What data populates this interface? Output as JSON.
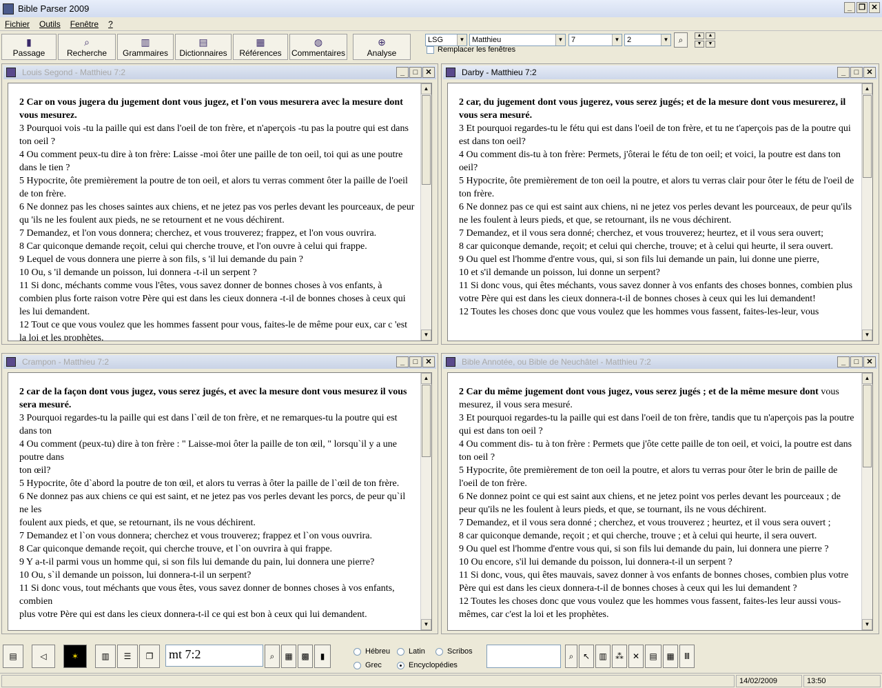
{
  "app": {
    "title": "Bible Parser 2009"
  },
  "menu": [
    "Fichier",
    "Outils",
    "Fenêtre",
    "?"
  ],
  "toolbar": {
    "buttons": [
      "Passage",
      "Recherche",
      "Grammaires",
      "Dictionnaires",
      "Références",
      "Commentaires",
      "Analyse"
    ],
    "version": "LSG",
    "book": "Matthieu",
    "chapter": "7",
    "verse": "2",
    "replace_windows_label": "Remplacer les fenêtres"
  },
  "panes": [
    {
      "title": "Louis Segond - Matthieu 7:2",
      "first_verse": "2 Car on vous jugera du jugement dont vous jugez, et l'on vous mesurera avec la mesure dont vous mesurez.",
      "verses": [
        "3 Pourquoi vois -tu la paille qui est dans l'oeil de ton frère, et n'aperçois -tu pas la poutre qui est dans ton oeil ?",
        "4 Ou comment peux-tu dire à ton frère: Laisse -moi ôter une paille de ton oeil, toi qui as une poutre dans le tien ?",
        "5 Hypocrite, ôte premièrement la poutre de ton oeil, et alors tu verras comment ôter la paille de l'oeil de ton frère.",
        "6 Ne donnez pas les choses saintes aux chiens, et ne jetez pas vos perles devant les pourceaux, de peur qu 'ils ne les foulent aux pieds, ne se retournent et ne vous déchirent.",
        "7 Demandez, et l'on vous donnera; cherchez, et vous trouverez; frappez, et l'on vous ouvrira.",
        "8 Car quiconque demande reçoit, celui qui cherche trouve, et l'on ouvre à celui qui frappe.",
        "9 Lequel de vous donnera une pierre à son fils, s 'il lui demande du pain ?",
        "10 Ou, s 'il demande un poisson, lui donnera -t-il un serpent ?",
        "11 Si donc, méchants comme vous l'êtes, vous savez donner de bonnes choses à vos enfants, à combien plus forte raison votre Père qui est dans les cieux donnera -t-il de bonnes choses à ceux qui les lui demandent.",
        "12 Tout ce que vous voulez que les hommes fassent pour vous, faites-le de même pour eux, car c 'est la loi et les prophètes."
      ]
    },
    {
      "title": "Darby - Matthieu 7:2",
      "first_verse": "2 car, du jugement dont vous jugerez, vous serez jugés; et de la mesure dont vous mesurerez, il vous sera mesuré.",
      "verses": [
        "3 Et pourquoi regardes-tu le fétu qui est dans l'oeil de ton frère, et tu ne t'aperçois pas de la poutre qui est dans ton oeil?",
        "4 Ou comment dis-tu à ton frère: Permets, j'ôterai le fétu de ton oeil; et voici, la poutre est dans ton oeil?",
        "5 Hypocrite, ôte premièrement de ton oeil la poutre, et alors tu verras clair pour ôter le fétu de l'oeil de ton frère.",
        "6 Ne donnez pas ce qui est saint aux chiens, ni ne jetez vos perles devant les pourceaux, de peur qu'ils ne les foulent à leurs pieds, et que, se retournant, ils ne vous déchirent.",
        "7 Demandez, et il vous sera donné; cherchez, et vous trouverez; heurtez, et il vous sera ouvert;",
        "8 car quiconque demande, reçoit; et celui qui cherche, trouve; et à celui qui heurte, il sera ouvert.",
        "9 Ou quel est l'homme d'entre vous, qui, si son fils lui demande un pain, lui donne une pierre,",
        "10 et s'il demande un poisson, lui donne un serpent?",
        "11 Si donc vous, qui êtes méchants, vous savez donner à vos enfants des choses bonnes, combien plus votre Père qui est dans les cieux donnera-t-il de bonnes choses à ceux qui les lui demandent!",
        "12 Toutes les choses donc que vous voulez que les hommes vous fassent, faites-les-leur, vous"
      ]
    },
    {
      "title": "Crampon - Matthieu 7:2",
      "first_verse": "2 car de la façon dont vous jugez, vous serez jugés, et avec la mesure dont vous mesurez il vous sera mesuré.",
      "verses": [
        "3 Pourquoi regardes-tu la paille qui est dans l`œil de ton frère, et ne remarques-tu la poutre qui est dans ton",
        "4 Ou comment (peux-tu) dire à ton frère : \" Laisse-moi ôter la paille de ton œil, \" lorsqu`il y a une poutre dans",
        "ton œil?",
        "5 Hypocrite, ôte d`abord la poutre de ton œil, et alors tu verras à ôter la paille de l`œil de ton frère.",
        "6 Ne donnez pas aux chiens ce qui est saint, et ne jetez pas vos perles devant les porcs, de peur qu`il ne les",
        "foulent aux pieds, et que, se retournant, ils ne vous déchirent.",
        "7 Demandez et l`on vous donnera; cherchez et vous trouverez; frappez et l`on vous ouvrira.",
        "8 Car quiconque demande reçoit, qui cherche trouve, et l`on ouvrira à qui frappe.",
        "9 Y a-t-il parmi vous un homme qui, si son fils lui demande du pain, lui donnera une pierre?",
        "10 Ou, s`il demande un poisson, lui donnera-t-il un serpent?",
        "11 Si donc vous, tout méchants que vous êtes, vous savez donner de bonnes choses à vos enfants, combien",
        "plus votre Père qui est dans les cieux donnera-t-il ce qui est bon à ceux qui lui demandent."
      ]
    },
    {
      "title": "Bible Annotée, ou Bible de Neuchâtel - Matthieu 7:2",
      "first_verse_bold": "2 Car du même jugement dont vous jugez, vous serez jugés ; et de la même mesure dont",
      "first_verse_rest": " vous mesurez, il vous sera mesuré.",
      "verses": [
        "3 Et pourquoi regardes-tu la paille qui est dans l'oeil de ton frère, tandis que tu n'aperçois pas la poutre qui est dans ton oeil ?",
        "4 Ou comment dis- tu à ton frère : Permets que j'ôte cette paille de ton oeil, et voici, la poutre est dans ton oeil ?",
        "5 Hypocrite, ôte premièrement de ton oeil la poutre, et alors tu verras pour ôter le brin de paille de l'oeil de ton frère.",
        "6 Ne donnez point ce qui est saint aux chiens, et ne jetez point vos perles devant les pourceaux ; de peur qu'ils ne les foulent à leurs pieds, et que, se tournant, ils ne vous déchirent.",
        "7 Demandez, et il vous sera donné ; cherchez, et vous trouverez ; heurtez, et il vous sera ouvert ;",
        "8 car quiconque demande, reçoit ; et qui cherche, trouve ; et à celui qui heurte, il sera ouvert.",
        "9 Ou quel est l'homme d'entre vous qui, si son fils lui demande du pain, lui donnera une pierre ?",
        "10 Ou encore, s'il lui demande du poisson, lui donnera-t-il un serpent ?",
        "11 Si donc, vous, qui êtes mauvais, savez donner à vos enfants de bonnes choses, combien plus votre Père qui est dans les cieux donnera-t-il de bonnes choses à ceux qui les lui demandent ?",
        "12 Toutes les choses donc que vous voulez que les hommes vous fassent, faites-les leur aussi vous-mêmes, car c'est la loi et les prophètes."
      ]
    }
  ],
  "bottombar": {
    "reference": "mt 7:2",
    "radios": [
      {
        "label": "Hébreu",
        "checked": false
      },
      {
        "label": "Latin",
        "checked": false
      },
      {
        "label": "Scribos",
        "checked": false
      },
      {
        "label": "Grec",
        "checked": false
      },
      {
        "label": "Encyclopédies",
        "checked": true
      }
    ]
  },
  "status": {
    "date": "14/02/2009",
    "time": "13:50"
  }
}
